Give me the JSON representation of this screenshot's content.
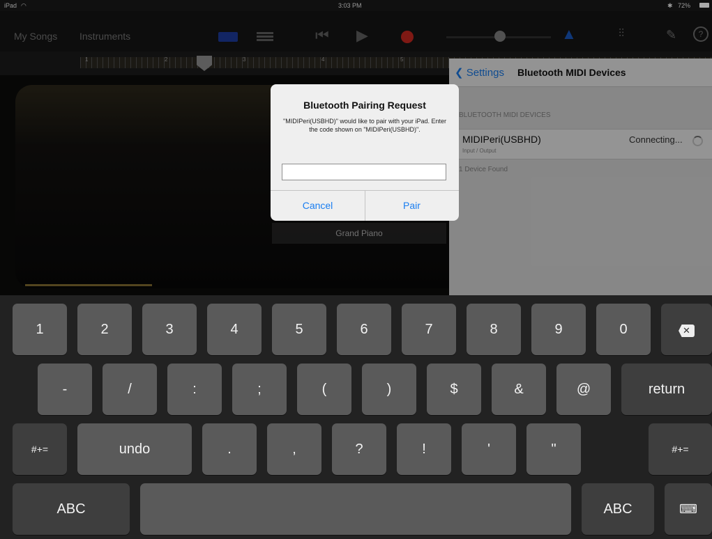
{
  "status": {
    "device": "iPad",
    "time": "3:03 PM",
    "battery": "72%"
  },
  "toolbar": {
    "my_songs": "My Songs",
    "instruments": "Instruments"
  },
  "ruler": {
    "marks": [
      "1",
      "2",
      "3",
      "4",
      "5"
    ]
  },
  "instrument": {
    "name": "Grand Piano"
  },
  "settings": {
    "back_label": "Settings",
    "title": "Bluetooth MIDI Devices",
    "section_header": "BLUETOOTH MIDI DEVICES",
    "device": {
      "name": "MIDIPeri(USBHD)",
      "sub": "Input / Output",
      "status": "Connecting..."
    },
    "found": "1 Device Found"
  },
  "alert": {
    "title": "Bluetooth Pairing Request",
    "message": "\"MIDIPeri(USBHD)\" would like to pair with your iPad. Enter the code shown on \"MIDIPeri(USBHD)\".",
    "input_value": "",
    "cancel": "Cancel",
    "pair": "Pair"
  },
  "keyboard": {
    "row1": [
      "1",
      "2",
      "3",
      "4",
      "5",
      "6",
      "7",
      "8",
      "9",
      "0"
    ],
    "row2": [
      "-",
      "/",
      ":",
      ";",
      "(",
      ")",
      "$",
      "&",
      "@"
    ],
    "return": "return",
    "shift_left": "#+=",
    "undo": "undo",
    "row3": [
      ".",
      ",",
      "?",
      "!",
      "'",
      "\""
    ],
    "shift_right": "#+=",
    "abc_left": "ABC",
    "abc_right": "ABC"
  }
}
